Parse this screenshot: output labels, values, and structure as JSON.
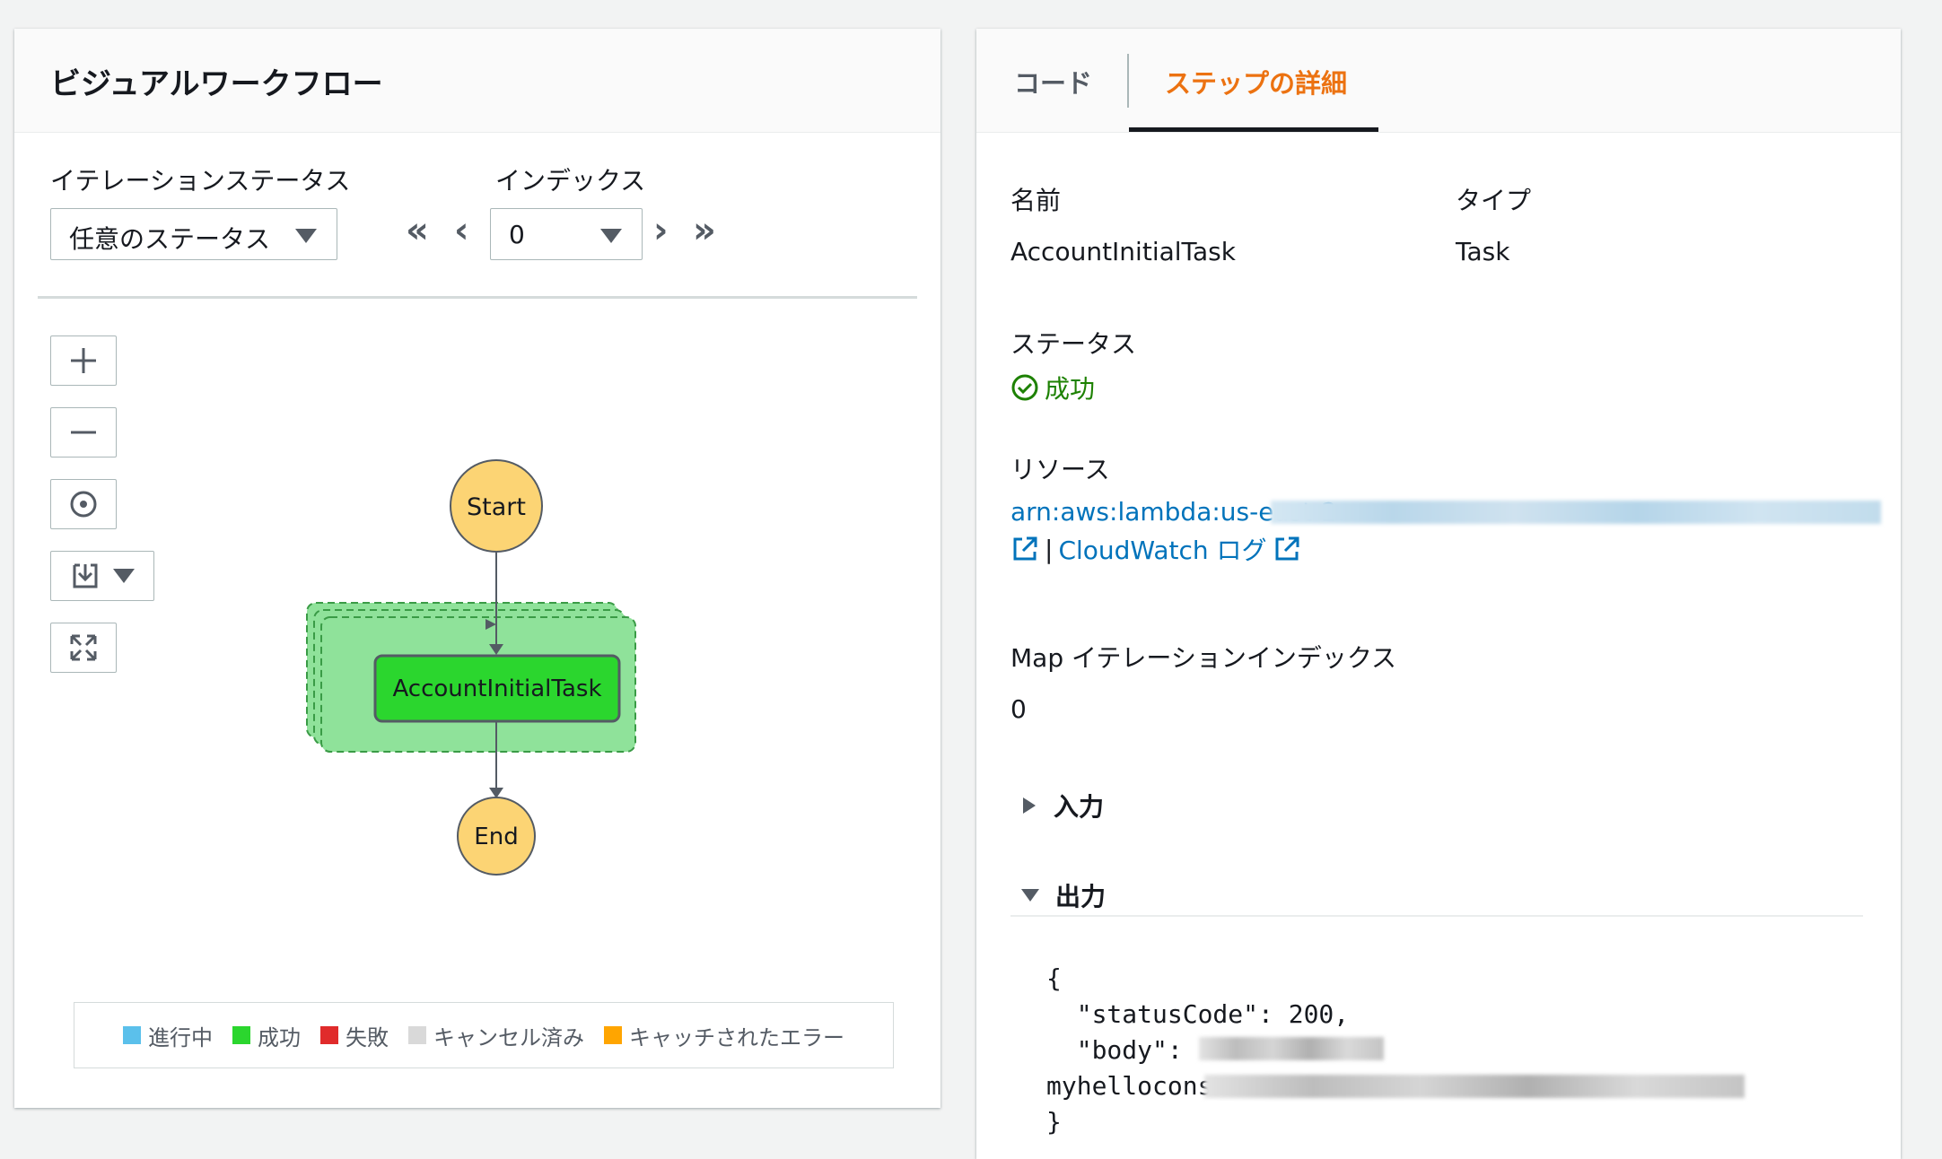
{
  "left": {
    "title": "ビジュアルワークフロー",
    "iteration_status_label": "イテレーションステータス",
    "iteration_status_value": "任意のステータス",
    "index_label": "インデックス",
    "index_value": "0",
    "nav": {
      "first": "«",
      "prev": "‹",
      "next": "›",
      "last": "»"
    },
    "graph": {
      "start": "Start",
      "task": "AccountInitialTask",
      "end": "End"
    },
    "legend": [
      {
        "label": "進行中",
        "color": "#5bc0eb"
      },
      {
        "label": "成功",
        "color": "#2bd62e"
      },
      {
        "label": "失敗",
        "color": "#e02b2b"
      },
      {
        "label": "キャンセル済み",
        "color": "#d9d9d9"
      },
      {
        "label": "キャッチされたエラー",
        "color": "#ffa500"
      }
    ]
  },
  "right": {
    "tabs": {
      "code": "コード",
      "details": "ステップの詳細"
    },
    "name_label": "名前",
    "name_value": "AccountInitialTask",
    "type_label": "タイプ",
    "type_value": "Task",
    "status_label": "ステータス",
    "status_value": "成功",
    "resource_label": "リソース",
    "resource_arn": "arn:aws:lambda:us-east-2:",
    "separator": "|",
    "cloudwatch_link": "CloudWatch ログ",
    "map_index_label": "Map イテレーションインデックス",
    "map_index_value": "0",
    "input_label": "入力",
    "output_label": "出力",
    "output_lines": [
      "{",
      "  \"statusCode\": 200,",
      "  \"body\": ",
      "myhellocons",
      "}"
    ]
  },
  "colors": {
    "accent": "#ec7211",
    "link": "#0073bb",
    "success": "#1d8102"
  }
}
